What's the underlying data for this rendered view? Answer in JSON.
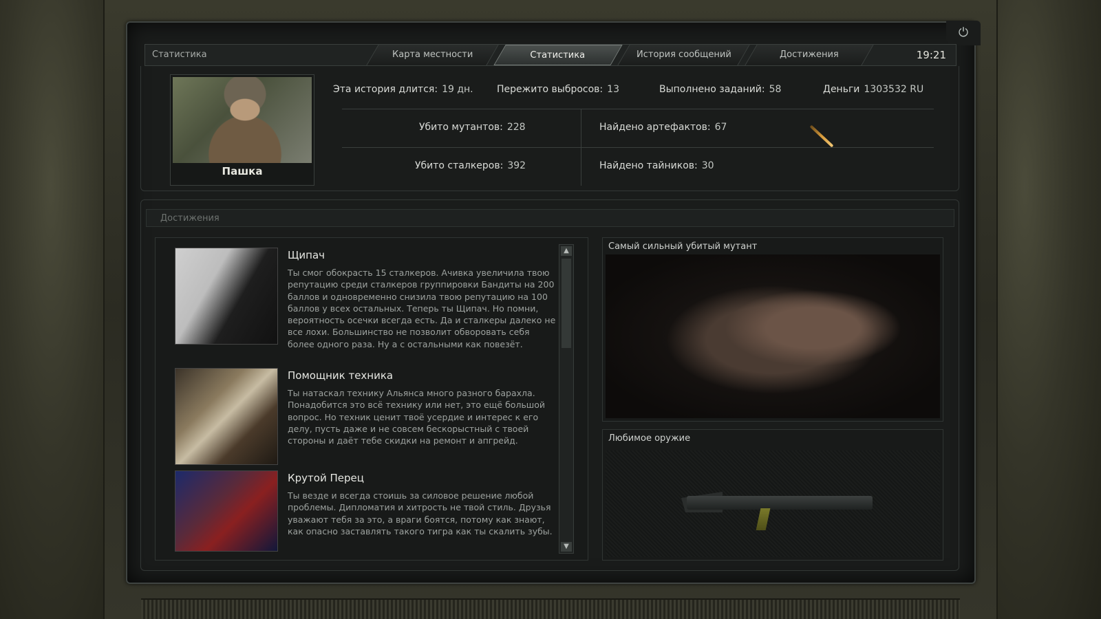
{
  "window": {
    "title": "Статистика",
    "clock": "19:21"
  },
  "tabs": [
    {
      "label": "Карта местности",
      "active": false
    },
    {
      "label": "Статистика",
      "active": true
    },
    {
      "label": "История сообщений",
      "active": false
    },
    {
      "label": "Достижения",
      "active": false
    }
  ],
  "player": {
    "name": "Пашка"
  },
  "stats": {
    "days": {
      "label": "Эта история длится:",
      "value": "19 дн."
    },
    "emissions": {
      "label": "Пережито выбросов:",
      "value": "13"
    },
    "tasks": {
      "label": "Выполнено заданий:",
      "value": "58"
    },
    "money": {
      "label": "Деньги",
      "value": "1303532 RU"
    },
    "mutants": {
      "label": "Убито мутантов:",
      "value": "228"
    },
    "artifacts": {
      "label": "Найдено артефактов:",
      "value": "67"
    },
    "stalkers": {
      "label": "Убито сталкеров:",
      "value": "392"
    },
    "stashes": {
      "label": "Найдено тайников:",
      "value": "30"
    }
  },
  "achievements": {
    "header": "Достижения",
    "items": [
      {
        "title": "Щипач",
        "desc": "Ты смог обокрасть 15 сталкеров. Ачивка увеличила твою репутацию среди сталкеров группировки Бандиты на 200 баллов и одновременно снизила твою репутацию на 100 баллов у всех остальных. Теперь ты Щипач. Но помни, вероятность осечки всегда есть. Да и сталкеры далеко не все лохи. Большинство не позволит обворовать себя более одного раза. Ну а с остальными как повезёт."
      },
      {
        "title": "Помощник техника",
        "desc": "Ты натаскал технику Альянса много разного барахла. Понадобится это всё технику или нет, это ещё большой вопрос. Но техник ценит твоё усердие и интерес к его делу, пусть даже и не совсем бескорыстный с твоей стороны и даёт тебе скидки на ремонт и апгрейд."
      },
      {
        "title": "Крутой Перец",
        "desc": "Ты везде и всегда стоишь за силовое решение любой проблемы. Дипломатия и хитрость не твой стиль. Друзья уважают тебя за это, а враги боятся, потому как знают, как опасно заставлять такого тигра как ты скалить зубы."
      }
    ]
  },
  "panels": {
    "mutant_title": "Самый сильный убитый мутант",
    "weapon_title": "Любимое оружие"
  },
  "icons": {
    "power": "power-icon",
    "scroll_up": "chevron-up-icon",
    "scroll_down": "chevron-down-icon"
  }
}
